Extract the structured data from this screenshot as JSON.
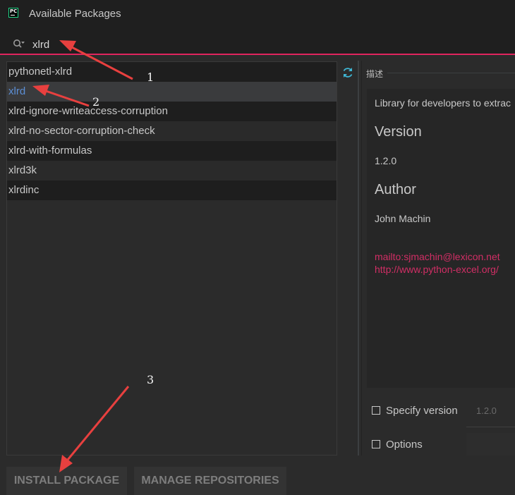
{
  "window": {
    "title": "Available Packages",
    "icon": "pycharm-icon"
  },
  "search": {
    "value": "xlrd",
    "icon": "search-icon"
  },
  "packages": [
    "pythonetl-xlrd",
    "xlrd",
    "xlrd-ignore-writeaccess-corruption",
    "xlrd-no-sector-corruption-check",
    "xlrd-with-formulas",
    "xlrd3k",
    "xlrdinc"
  ],
  "selected_package": "xlrd",
  "description": {
    "section_label": "描述",
    "text": "Library for developers to extrac",
    "version_heading": "Version",
    "version": "1.2.0",
    "author_heading": "Author",
    "author": "John Machin",
    "email_link": "mailto:sjmachin@lexicon.net",
    "url_link": "http://www.python-excel.org/"
  },
  "options": {
    "specify_version_label": "Specify version",
    "specify_version_value": "1.2.0",
    "options_label": "Options"
  },
  "buttons": {
    "install": "INSTALL PACKAGE",
    "manage": "MANAGE REPOSITORIES"
  },
  "annotations": [
    "1",
    "2",
    "3"
  ],
  "colors": {
    "accent": "#e0245e",
    "link": "#d12e65",
    "selected_text": "#5c8fd6",
    "arrow": "#e8403f"
  }
}
